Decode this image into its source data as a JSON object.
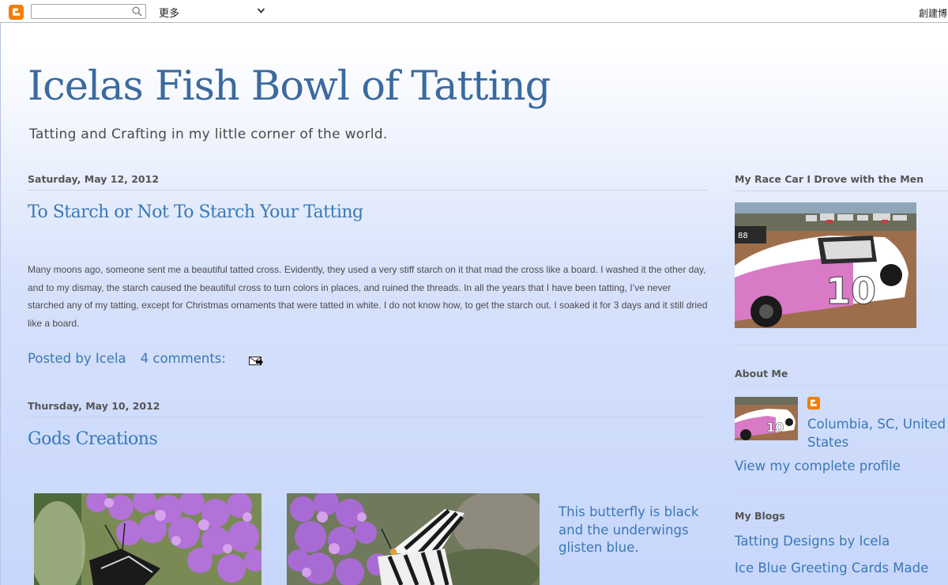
{
  "navbar": {
    "more_label": "更多",
    "create_label": "創建博"
  },
  "header": {
    "title": "Icelas Fish Bowl of Tatting",
    "description": "Tatting and Crafting in my little corner of the world."
  },
  "posts": [
    {
      "date": "Saturday, May 12, 2012",
      "title": "To Starch or Not To Starch Your Tatting",
      "body": "Many moons ago, someone sent me a beautiful tatted cross. Evidently, they used a very stiff starch on it that mad the cross like a board. I washed it the other day, and to my dismay, the starch caused the beautiful cross to turn colors in places, and ruined the threads.  In all the years that I have been tatting, I’ve never starched any of my tatting, except for Christmas ornaments that were tatted in white.  I do not know how, to get the starch out.  I soaked it for 3 days and it still dried like a board.",
      "posted_by": "Posted by Icela",
      "comments": "4 comments:"
    },
    {
      "date": "Thursday, May 10, 2012",
      "title": "Gods Creations",
      "caption": "This butterfly is black and the underwings glisten blue."
    }
  ],
  "sidebar": {
    "race_car_title": "My Race Car I Drove with the Men",
    "about_title": "About Me",
    "location": "Columbia, SC, United States",
    "view_profile": "View my complete profile",
    "blogs_title": "My Blogs",
    "blogs": [
      "Tatting Designs by Icela",
      "Ice Blue Greeting Cards Made"
    ]
  },
  "colors": {
    "link": "#3a78b4",
    "title": "#3a6aa0",
    "blogger_orange": "#f57d00"
  }
}
